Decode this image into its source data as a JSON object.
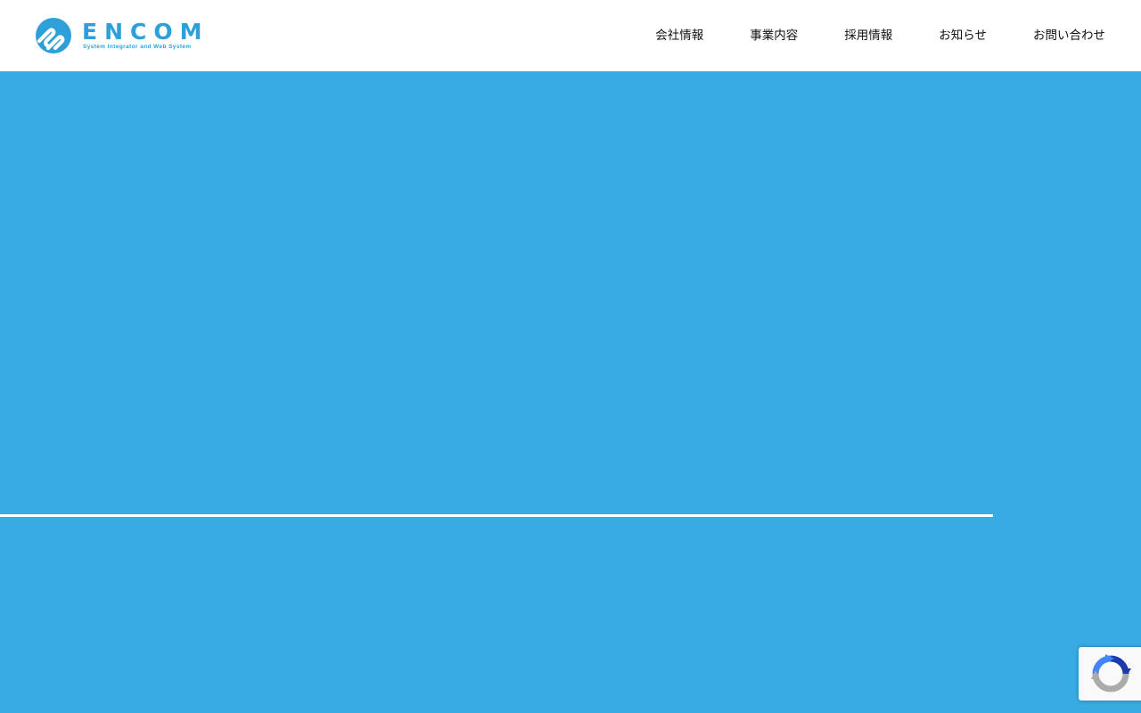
{
  "header": {
    "logo": {
      "name": "ENCOM",
      "tagline": "System Integrator and Web System",
      "icon": "encom-logo-icon"
    },
    "nav": [
      {
        "label": "会社情報"
      },
      {
        "label": "事業内容"
      },
      {
        "label": "採用情報"
      },
      {
        "label": "お知らせ"
      },
      {
        "label": "お問い合わせ"
      }
    ]
  },
  "colors": {
    "brand": "#2e9fd8",
    "hero_background": "#37ace4",
    "header_background": "#ffffff",
    "nav_text": "#111111",
    "hero_line": "#ffffff"
  },
  "recaptcha": {
    "icon": "recaptcha-icon"
  }
}
